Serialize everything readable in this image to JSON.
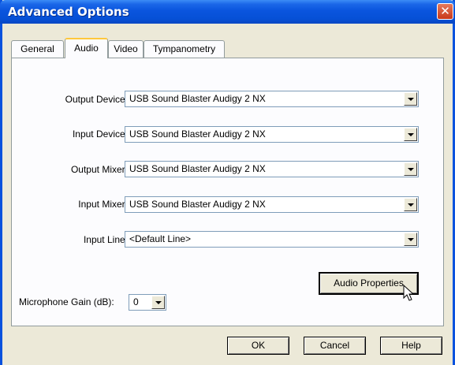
{
  "window": {
    "title": "Advanced Options"
  },
  "tabs": [
    {
      "label": "General"
    },
    {
      "label": "Audio",
      "active": true
    },
    {
      "label": "Video"
    },
    {
      "label": "Tympanometry"
    }
  ],
  "audio": {
    "rows": [
      {
        "label": "Output Device:",
        "value": "USB Sound Blaster Audigy 2 NX"
      },
      {
        "label": "Input Device:",
        "value": "USB Sound Blaster Audigy 2 NX"
      },
      {
        "label": "Output Mixer:",
        "value": "USB Sound Blaster Audigy 2 NX"
      },
      {
        "label": "Input Mixer:",
        "value": "USB Sound Blaster Audigy 2 NX"
      },
      {
        "label": "Input Line:",
        "value": "<Default Line>"
      }
    ],
    "properties_button": "Audio Properties",
    "mic_gain": {
      "label": "Microphone Gain (dB):",
      "value": "0"
    }
  },
  "buttons": {
    "ok": "OK",
    "cancel": "Cancel",
    "help": "Help"
  },
  "icons": {
    "close": "close-icon",
    "dropdown": "chevron-down-icon",
    "cursor": "mouse-pointer-icon"
  },
  "colors": {
    "titlebar": "#0a55de",
    "dialog": "#ece9d8",
    "close": "#c9381a",
    "tab_highlight": "#ffc83c"
  }
}
